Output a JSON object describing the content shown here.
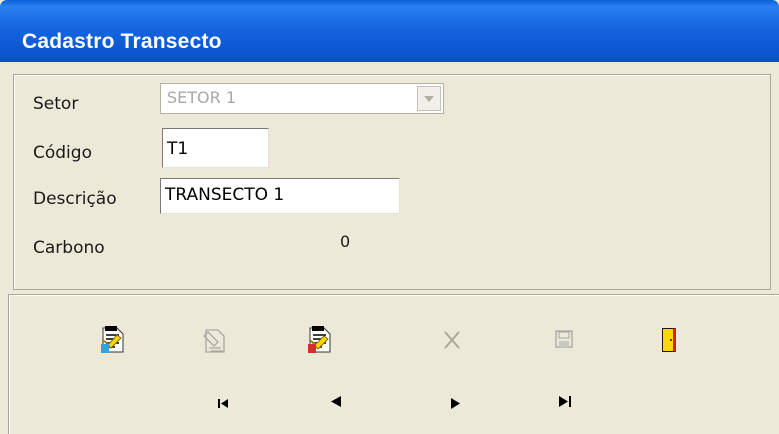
{
  "window": {
    "title": "Cadastro Transecto"
  },
  "form": {
    "setor": {
      "label": "Setor",
      "value": "SETOR 1"
    },
    "codigo": {
      "label": "Código",
      "value": "T1"
    },
    "descricao": {
      "label": "Descrição",
      "value": "TRANSECTO 1"
    },
    "carbono": {
      "label": "Carbono",
      "value": "0"
    }
  },
  "toolbar": {
    "buttons": [
      {
        "icon": "new-record-icon",
        "enabled": true
      },
      {
        "icon": "edit-record-icon",
        "enabled": false
      },
      {
        "icon": "delete-record-icon",
        "enabled": true
      },
      {
        "icon": "cancel-icon",
        "enabled": false
      },
      {
        "icon": "save-icon",
        "enabled": false
      },
      {
        "icon": "exit-door-icon",
        "enabled": true
      }
    ]
  },
  "navigator": {
    "buttons": [
      {
        "icon": "first-record-icon"
      },
      {
        "icon": "prior-record-icon"
      },
      {
        "icon": "next-record-icon"
      },
      {
        "icon": "last-record-icon"
      }
    ]
  },
  "colors": {
    "titlebar": "#0a5fd8",
    "panel": "#ece9d8",
    "disabled_text": "#a8a8a8"
  }
}
